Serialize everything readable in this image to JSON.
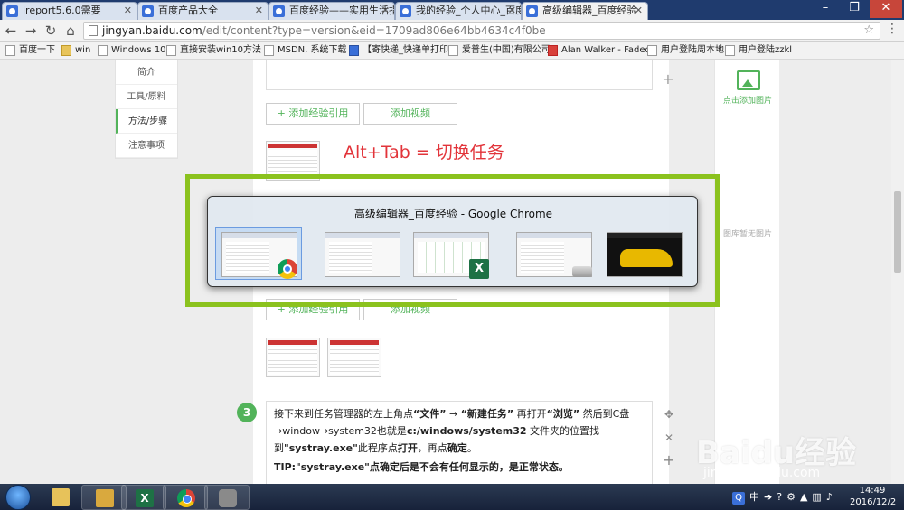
{
  "tabs": [
    {
      "label": "ireport5.6.0需要"
    },
    {
      "label": "百度产品大全"
    },
    {
      "label": "百度经验——实用生活指"
    },
    {
      "label": "我的经验_个人中心_百度"
    },
    {
      "label": "高级编辑器_百度经验"
    }
  ],
  "address": {
    "host": "jingyan.baidu.com",
    "path": "/edit/content?type=version&eid=1709ad806e64bb4634c4f0be"
  },
  "bookmarks": [
    {
      "label": "百度一下"
    },
    {
      "label": "win"
    },
    {
      "label": "Windows 10"
    },
    {
      "label": "直接安装win10方法"
    },
    {
      "label": "MSDN, 系统下载"
    },
    {
      "label": "【寄快递_快递单打印"
    },
    {
      "label": "爱普生(中国)有限公司"
    },
    {
      "label": "Alan Walker - Faded"
    },
    {
      "label": "用户登陆周本地"
    },
    {
      "label": "用户登陆zzkl"
    }
  ],
  "leftnav": [
    {
      "label": "简介"
    },
    {
      "label": "工具/原料"
    },
    {
      "label": "方法/步骤"
    },
    {
      "label": "注意事项"
    }
  ],
  "editor": {
    "add_reference_label": "+ 添加经验引用",
    "add_video_label": "添加视频",
    "caption": "Alt+Tab  =  切换任务"
  },
  "step3": {
    "number": "3",
    "text_a": "接下来到任务管理器的左上角点",
    "text_file": "“文件”",
    "text_arrow1": " → ",
    "text_newtask": "“新建任务”",
    "text_b": " 再打开",
    "text_browse": "“浏览”",
    "text_c": " 然后到C盘→window→system32也就是",
    "text_path": "c:/windows/system32",
    "text_d": " 文件夹的位置找到",
    "text_exe": "\"systray.exe\"",
    "text_e": "此程序点",
    "text_open": "打开",
    "text_f": "，再点",
    "text_ok": "确定",
    "text_g": "。",
    "tip": "TIP:\"systray.exe\"点确定后是不会有任何显示的，是正常状态。"
  },
  "rightpanel": {
    "add_image_label": "点击添加图片",
    "empty_label": "图库暂无图片"
  },
  "alt_tab": {
    "window_title": "高级编辑器_百度经验 - Google Chrome",
    "windows": [
      {
        "app_icon": "chrome-icon"
      },
      {
        "app_icon": "none"
      },
      {
        "app_icon": "excel-icon"
      },
      {
        "app_icon": "drive-icon"
      },
      {
        "app_icon": "none"
      }
    ]
  },
  "watermark": {
    "logo_text": "Baidu经验",
    "url": "jingyan.baidu.com"
  },
  "taskbar": {
    "ime_label": "中",
    "clock_time": "14:49",
    "clock_date": "2016/12/2"
  },
  "colors": {
    "accent_green": "#52b35a",
    "highlight_frame": "#8bc21e",
    "caption_red": "#e2343a"
  }
}
